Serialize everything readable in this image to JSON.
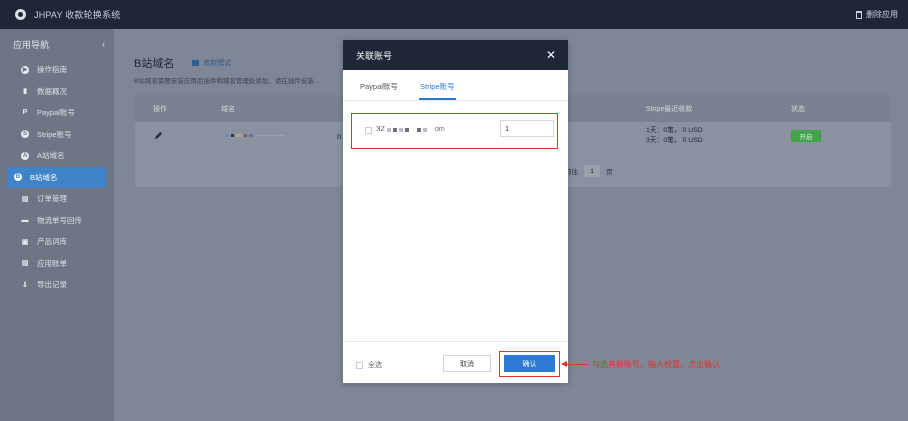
{
  "topbar": {
    "title": "JHPAY 收款轮换系统",
    "delete_app": "删除应用"
  },
  "sidebar": {
    "title": "应用导航",
    "items": [
      {
        "label": "操作指南",
        "icon": "play-icon"
      },
      {
        "label": "数据概况",
        "icon": "bar-chart-icon"
      },
      {
        "label": "Paypal账号",
        "icon": "paypal-icon"
      },
      {
        "label": "Stripe账号",
        "icon": "stripe-icon"
      },
      {
        "label": "A站域名",
        "icon": "a-site-icon"
      },
      {
        "label": "B站域名",
        "icon": "b-site-icon",
        "active": true
      },
      {
        "label": "订单管理",
        "icon": "order-icon"
      },
      {
        "label": "物流单号回传",
        "icon": "truck-icon"
      },
      {
        "label": "产品词库",
        "icon": "library-icon"
      },
      {
        "label": "应用账单",
        "icon": "bill-icon"
      },
      {
        "label": "导出记录",
        "icon": "download-icon"
      }
    ]
  },
  "main": {
    "title": "B站域名",
    "tutorial": "收款模式",
    "description": "B站域名需要安装应用后插件和域名管理处添加。请在插件安装...",
    "columns": {
      "action": "操作",
      "domain": "域名",
      "stripe_recent": "Stripe最近收款",
      "status": "状态"
    },
    "row": {
      "domain_tail": "n",
      "stripe_line1": "1天：0笔，  0 USD",
      "stripe_line2": "3天：0笔，  0 USD",
      "status": "开启"
    },
    "pager": {
      "goto": "前往",
      "page": "1",
      "unit": "页"
    }
  },
  "modal": {
    "title": "关联账号",
    "tabs": [
      "Paypal账号",
      "Stripe账号"
    ],
    "active_tab": 1,
    "account": {
      "name_tail": "om",
      "quantity": "1"
    },
    "select_all": "全选",
    "cancel": "取消",
    "confirm": "确认"
  },
  "annotation": "勾选关联账号，输入权重，点击确认",
  "colors": {
    "accent": "#2d7ad6",
    "highlight": "#e0342c",
    "header": "#1e2637",
    "status_green": "#43a34c"
  }
}
